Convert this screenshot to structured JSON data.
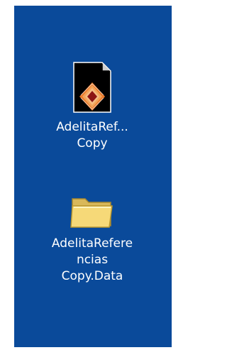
{
  "desktop": {
    "background_color": "#0a4a9a",
    "icons": [
      {
        "icon": "document-file-icon",
        "label": "AdelitaRef...\nCopy"
      },
      {
        "icon": "folder-icon",
        "label": "AdelitaRefere\nncias\nCopy.Data"
      }
    ]
  }
}
